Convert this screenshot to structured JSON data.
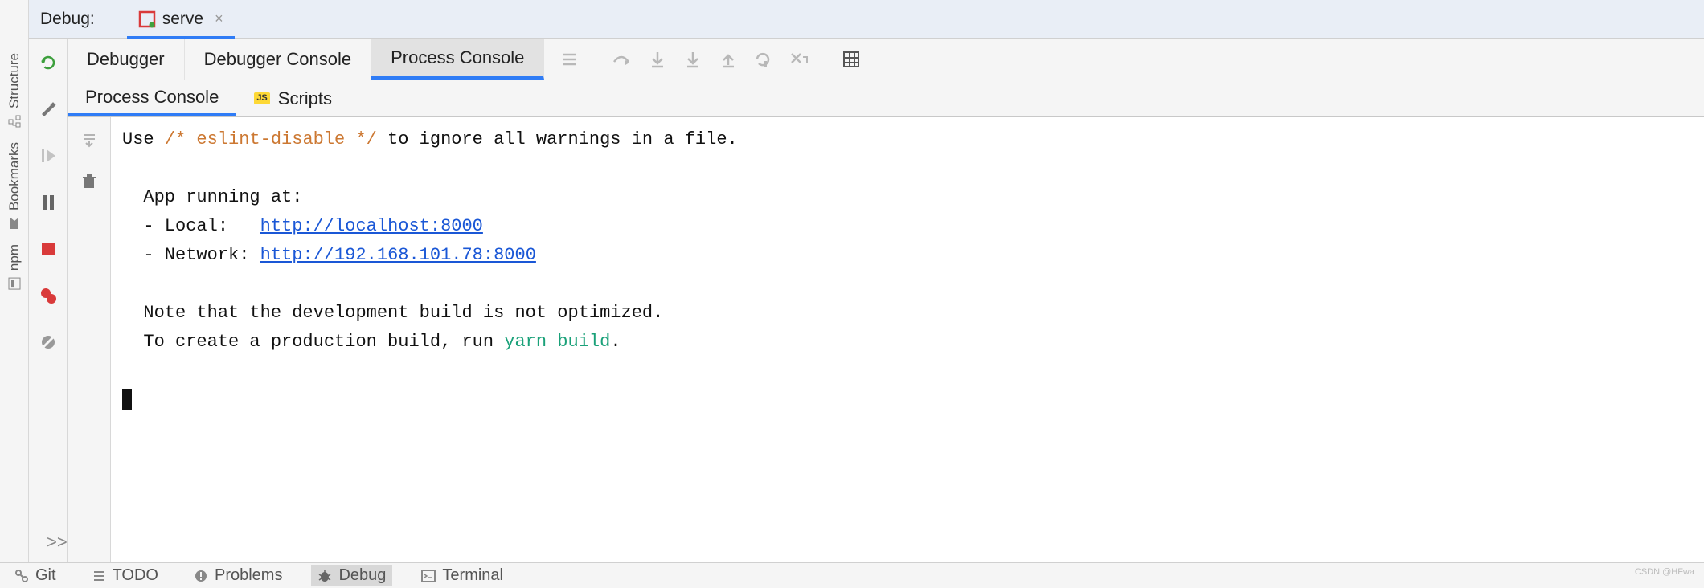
{
  "left_rail": {
    "structure_label": "Structure",
    "bookmarks_label": "Bookmarks",
    "npm_label": "npm"
  },
  "top": {
    "title": "Debug:",
    "run_config": "serve"
  },
  "tool_col": {
    "rerun": "rerun",
    "wrench": "settings",
    "resume": "resume",
    "pause": "pause",
    "stop": "stop",
    "breakpoints": "view-breakpoints",
    "mute": "mute-breakpoints"
  },
  "tabs": {
    "debugger": "Debugger",
    "debugger_console": "Debugger Console",
    "process_console": "Process Console"
  },
  "toolbar_icons": [
    "list",
    "step-over",
    "step-into",
    "force-step-into",
    "step-out",
    "run-to-cursor",
    "evaluate",
    "table"
  ],
  "subtabs": {
    "process_console": "Process Console",
    "scripts": "Scripts"
  },
  "console": {
    "line1_pre": "Use ",
    "line1_comment": "/* eslint-disable */",
    "line1_post": " to ignore all warnings in a file.",
    "app_running": "  App running at:",
    "local_label": "  - Local:   ",
    "local_url": "http://localhost:8000",
    "network_label": "  - Network: ",
    "network_url": "http://192.168.101.78:8000",
    "note1": "  Note that the development build is not optimized.",
    "note2_pre": "  To create a production build, run ",
    "note2_cmd": "yarn build",
    "note2_post": "."
  },
  "bottom": {
    "git": "Git",
    "todo": "TODO",
    "problems": "Problems",
    "debug": "Debug",
    "terminal": "Terminal"
  },
  "watermark": "CSDN @HFwa",
  "more": ">>"
}
